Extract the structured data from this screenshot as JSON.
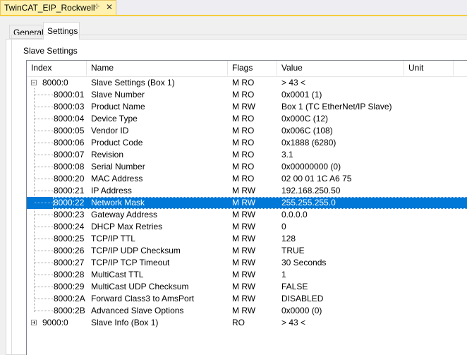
{
  "document_tab": {
    "title": "TwinCAT_EIP_Rockwell",
    "pin_icon": "⊹",
    "close_icon": "✕"
  },
  "property_tabs": [
    {
      "label": "General",
      "active": false
    },
    {
      "label": "Settings",
      "active": true
    }
  ],
  "group": {
    "label": "Slave Settings"
  },
  "columns": {
    "index": "Index",
    "name": "Name",
    "flags": "Flags",
    "value": "Value",
    "unit": "Unit"
  },
  "rows": [
    {
      "index": "8000:0",
      "name": "Slave Settings (Box 1)",
      "flags": "M RO",
      "value": "> 43 <",
      "level": 0,
      "expander": "minus"
    },
    {
      "index": "8000:01",
      "name": "Slave Number",
      "flags": "M RO",
      "value": "0x0001 (1)",
      "level": 1
    },
    {
      "index": "8000:03",
      "name": "Product Name",
      "flags": "M RW",
      "value": "Box 1 (TC EtherNet/IP Slave)",
      "level": 1
    },
    {
      "index": "8000:04",
      "name": "Device Type",
      "flags": "M RO",
      "value": "0x000C (12)",
      "level": 1
    },
    {
      "index": "8000:05",
      "name": "Vendor ID",
      "flags": "M RO",
      "value": "0x006C (108)",
      "level": 1
    },
    {
      "index": "8000:06",
      "name": "Product Code",
      "flags": "M RO",
      "value": "0x1888 (6280)",
      "level": 1
    },
    {
      "index": "8000:07",
      "name": "Revision",
      "flags": "M RO",
      "value": "3.1",
      "level": 1
    },
    {
      "index": "8000:08",
      "name": "Serial Number",
      "flags": "M RO",
      "value": "0x00000000 (0)",
      "level": 1
    },
    {
      "index": "8000:20",
      "name": "MAC Address",
      "flags": "M RO",
      "value": "02 00 01 1C A6 75",
      "level": 1
    },
    {
      "index": "8000:21",
      "name": "IP Address",
      "flags": "M RW",
      "value": "192.168.250.50",
      "level": 1
    },
    {
      "index": "8000:22",
      "name": "Network Mask",
      "flags": "M RW",
      "value": "255.255.255.0",
      "level": 1,
      "selected": true
    },
    {
      "index": "8000:23",
      "name": "Gateway Address",
      "flags": "M RW",
      "value": "0.0.0.0",
      "level": 1
    },
    {
      "index": "8000:24",
      "name": "DHCP Max Retries",
      "flags": "M RW",
      "value": "0",
      "level": 1
    },
    {
      "index": "8000:25",
      "name": "TCP/IP TTL",
      "flags": "M RW",
      "value": "128",
      "level": 1
    },
    {
      "index": "8000:26",
      "name": "TCP/IP UDP Checksum",
      "flags": "M RW",
      "value": "TRUE",
      "level": 1
    },
    {
      "index": "8000:27",
      "name": "TCP/IP TCP Timeout",
      "flags": "M RW",
      "value": "30 Seconds",
      "level": 1
    },
    {
      "index": "8000:28",
      "name": "MultiCast TTL",
      "flags": "M RW",
      "value": "1",
      "level": 1
    },
    {
      "index": "8000:29",
      "name": "MultiCast UDP Checksum",
      "flags": "M RW",
      "value": "FALSE",
      "level": 1
    },
    {
      "index": "8000:2A",
      "name": "Forward Class3 to AmsPort",
      "flags": "M RW",
      "value": "DISABLED",
      "level": 1
    },
    {
      "index": "8000:2B",
      "name": "Advanced Slave Options",
      "flags": "M RW",
      "value": "0x0000 (0)",
      "level": 1
    },
    {
      "index": "9000:0",
      "name": "Slave Info (Box 1)",
      "flags": "RO",
      "value": "> 43 <",
      "level": 0,
      "expander": "plus"
    }
  ]
}
